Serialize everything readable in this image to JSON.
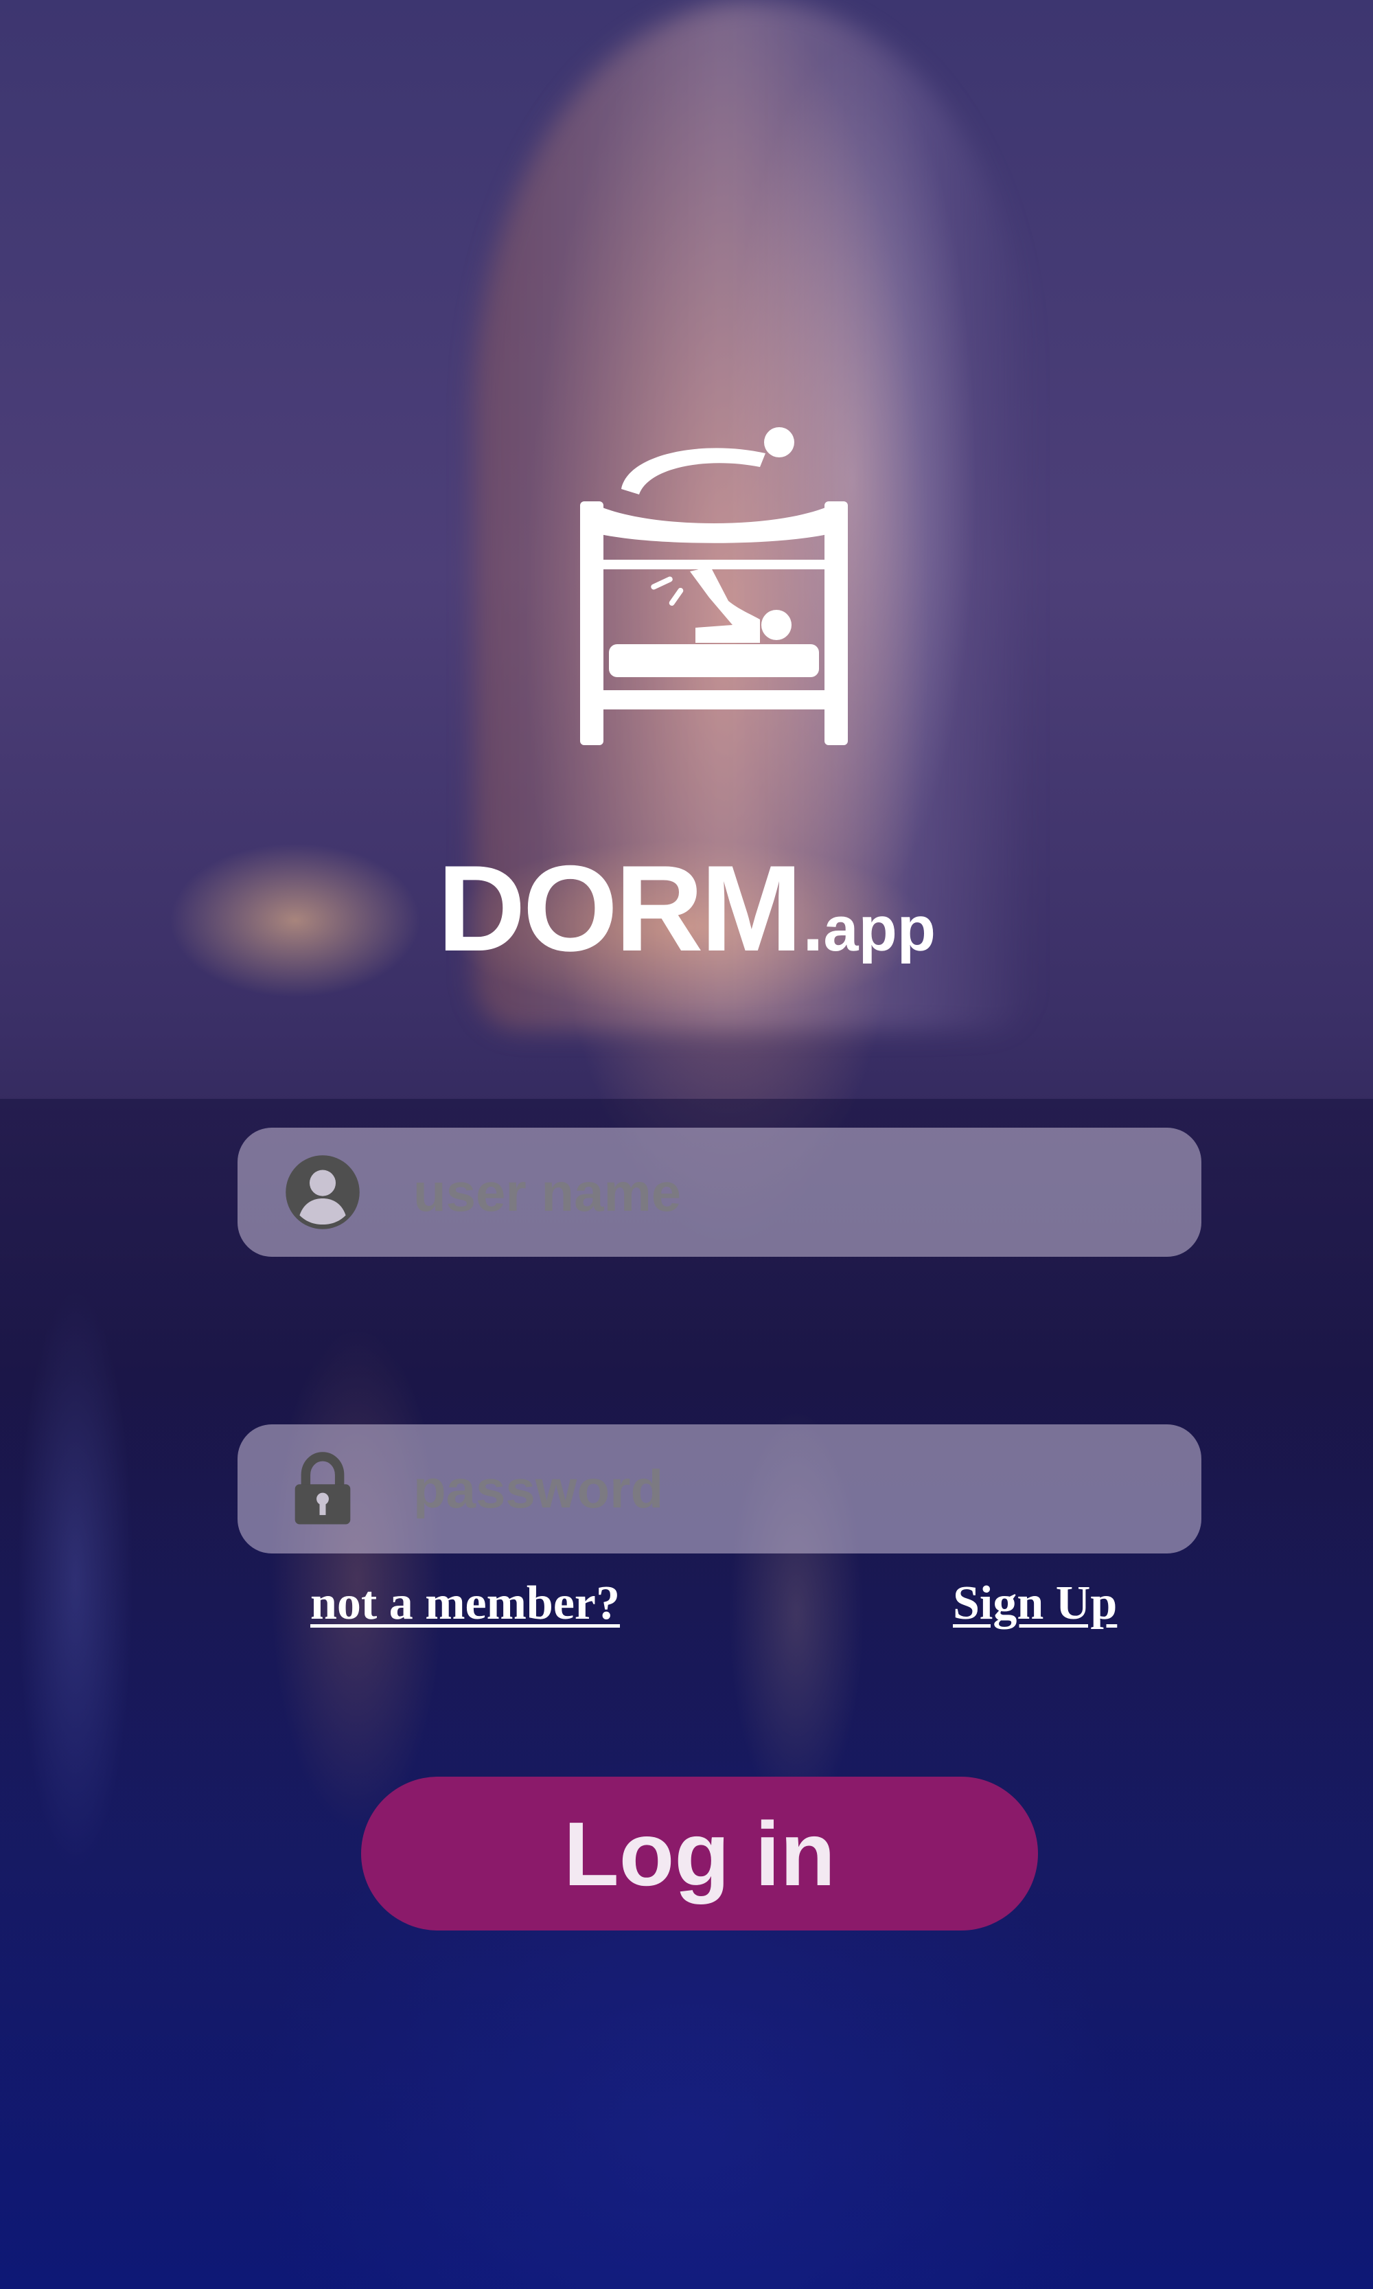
{
  "brand": {
    "logo_icon": "bunk-bed-icon",
    "name": "DORM",
    "dot": ".",
    "suffix": "app"
  },
  "login_form": {
    "username": {
      "icon": "user-icon",
      "placeholder": "user name",
      "value": ""
    },
    "password": {
      "icon": "lock-icon",
      "placeholder": "password",
      "value": ""
    },
    "member_prompt": "not a member?",
    "signup_label": "Sign Up",
    "submit_label": "Log in"
  },
  "colors": {
    "login_button": "#8b1a6a",
    "field_background": "rgba(200,190,215,0.55)",
    "text_white": "#ffffff"
  }
}
